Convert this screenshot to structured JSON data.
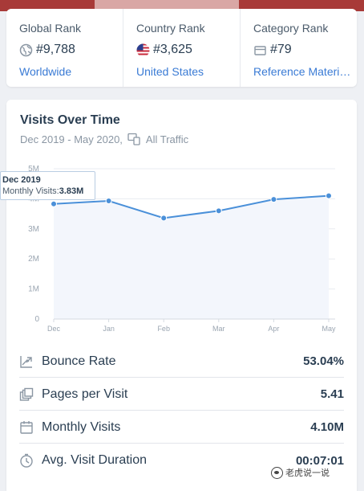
{
  "ranks": [
    {
      "title": "Global Rank",
      "value": "#9,788",
      "link": "Worldwide",
      "icon": "globe-icon"
    },
    {
      "title": "Country Rank",
      "value": "#3,625",
      "link": "United States",
      "icon": "us-flag-icon"
    },
    {
      "title": "Category Rank",
      "value": "#79",
      "link": "Reference Materi…",
      "icon": "category-icon"
    }
  ],
  "visits": {
    "title": "Visits Over Time",
    "date_range": "Dec 2019 - May 2020,",
    "traffic_label": "All Traffic",
    "tooltip": {
      "date": "Dec 2019",
      "label": "Monthly Visits:",
      "value": "3.83M"
    }
  },
  "chart_data": {
    "type": "area",
    "categories": [
      "Dec",
      "Jan",
      "Feb",
      "Mar",
      "Apr",
      "May"
    ],
    "series": [
      {
        "values": [
          3.83,
          3.93,
          3.36,
          3.6,
          3.98,
          4.1
        ]
      }
    ],
    "y_ticks": [
      "0",
      "1M",
      "2M",
      "3M",
      "4M",
      "5M"
    ],
    "ylim": [
      0,
      5
    ],
    "line_color": "#4a90d9",
    "fill_color": "#f3f6fc",
    "grid": true
  },
  "metrics": [
    {
      "label": "Bounce Rate",
      "value": "53.04%",
      "icon": "bounce-rate-icon"
    },
    {
      "label": "Pages per Visit",
      "value": "5.41",
      "icon": "pages-icon"
    },
    {
      "label": "Monthly Visits",
      "value": "4.10M",
      "icon": "calendar-icon"
    },
    {
      "label": "Avg. Visit Duration",
      "value": "00:07:01",
      "icon": "timer-icon"
    }
  ],
  "watermark": {
    "text": "老虎说一说"
  },
  "colors": {
    "accent": "#3a7bd5",
    "text": "#2a3e52",
    "muted": "#8a96a3"
  }
}
